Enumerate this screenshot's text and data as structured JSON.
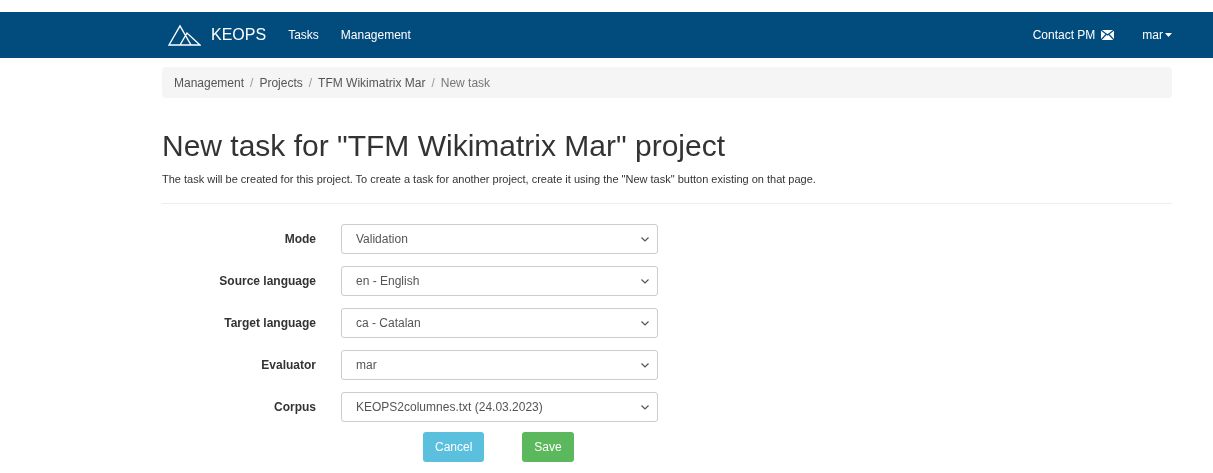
{
  "navbar": {
    "brand": "KEOPS",
    "links": [
      "Tasks",
      "Management"
    ],
    "contact": "Contact PM",
    "user": "mar"
  },
  "breadcrumb_separator": "/",
  "breadcrumb": [
    {
      "label": "Management",
      "current": false
    },
    {
      "label": "Projects",
      "current": false
    },
    {
      "label": "TFM Wikimatrix Mar",
      "current": false
    },
    {
      "label": "New task",
      "current": true
    }
  ],
  "title": "New task for \"TFM Wikimatrix Mar\" project",
  "description": "The task will be created for this project. To create a task for another project, create it using the \"New task\" button existing on that page.",
  "fields": [
    {
      "label": "Mode",
      "value": "Validation"
    },
    {
      "label": "Source language",
      "value": "en - English"
    },
    {
      "label": "Target language",
      "value": "ca - Catalan"
    },
    {
      "label": "Evaluator",
      "value": "mar"
    },
    {
      "label": "Corpus",
      "value": "KEOPS2columnes.txt (24.03.2023)"
    }
  ],
  "buttons": [
    {
      "label": "Cancel",
      "kind": "cancel"
    },
    {
      "label": "Save",
      "kind": "save"
    }
  ]
}
